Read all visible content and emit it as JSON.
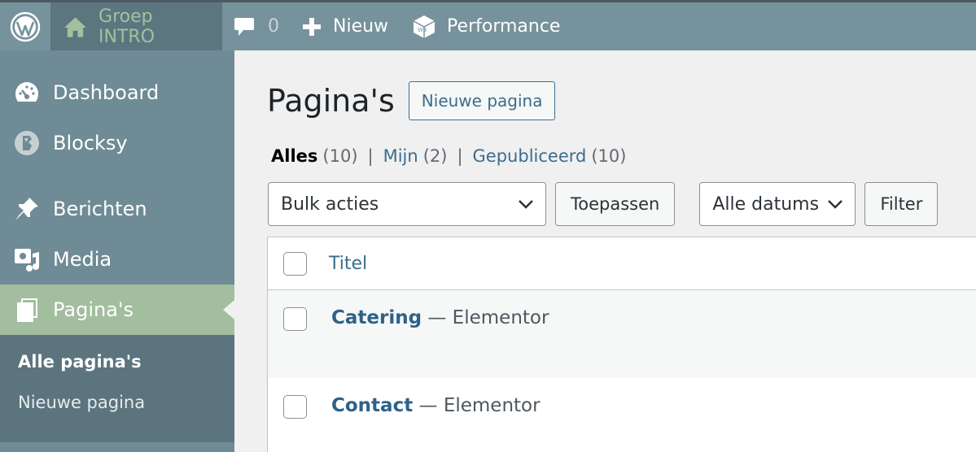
{
  "adminbar": {
    "site_name": "Groep INTRO",
    "comments_count": "0",
    "new_label": "Nieuw",
    "performance_label": "Performance"
  },
  "sidebar": {
    "items": [
      {
        "label": "Dashboard",
        "icon": "dashboard-icon"
      },
      {
        "label": "Blocksy",
        "icon": "blocksy-icon"
      },
      {
        "label": "Berichten",
        "icon": "pin-icon"
      },
      {
        "label": "Media",
        "icon": "media-icon"
      },
      {
        "label": "Pagina's",
        "icon": "pages-icon",
        "current": true
      }
    ],
    "submenu": [
      {
        "label": "Alle pagina's",
        "active": true
      },
      {
        "label": "Nieuwe pagina"
      }
    ]
  },
  "main": {
    "title": "Pagina's",
    "new_button": "Nieuwe pagina",
    "filters": {
      "all_label": "Alles",
      "all_count": "(10)",
      "mine_label": "Mijn",
      "mine_count": "(2)",
      "published_label": "Gepubliceerd",
      "published_count": "(10)"
    },
    "bulk_select": "Bulk acties",
    "apply_button": "Toepassen",
    "dates_select": "Alle datums",
    "filter_button": "Filter",
    "table": {
      "column_title": "Titel",
      "rows": [
        {
          "title": "Catering",
          "suffix": "— Elementor"
        },
        {
          "title": "Contact",
          "suffix": "— Elementor"
        }
      ]
    }
  },
  "colors": {
    "adminbar_bg": "#76929c",
    "sidebar_bg": "#6f8b95",
    "current_menu_bg": "#a3bd9f",
    "submenu_bg": "#5b747e",
    "link": "#3b6d8d"
  }
}
